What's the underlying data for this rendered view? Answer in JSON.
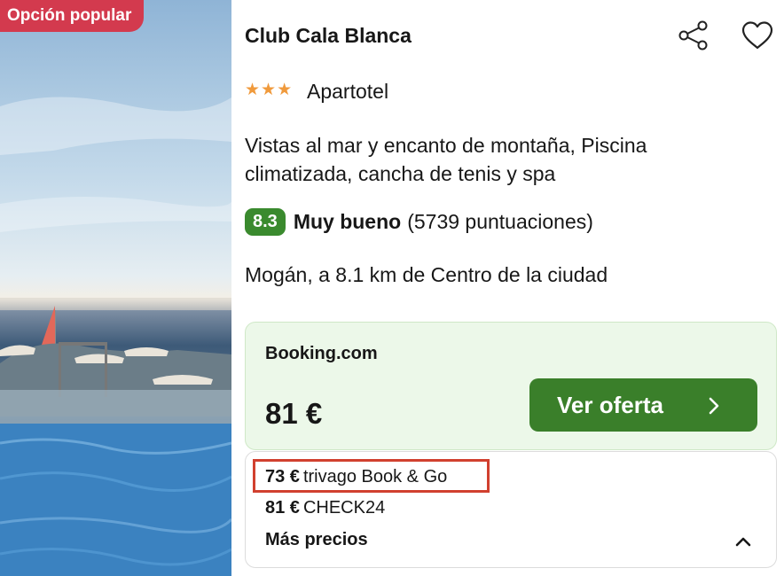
{
  "hero": {
    "badge": "Opción popular"
  },
  "hotel": {
    "name": "Club Cala Blanca",
    "stars": 3,
    "property_type": "Apartotel",
    "description": "Vistas al mar y encanto de montaña, Piscina climatizada, cancha de tenis y spa",
    "rating": {
      "score": "8.3",
      "label": "Muy bueno",
      "count": "(5739 puntuaciones)"
    },
    "location": "Mogán, a 8.1 km de Centro de la ciudad"
  },
  "actions": {
    "share_icon": "share-icon",
    "favorite_icon": "heart-icon"
  },
  "deal": {
    "provider": "Booking.com",
    "price": "81 €",
    "cta_label": "Ver oferta"
  },
  "other_offers": [
    {
      "price": "73 €",
      "provider": "trivago Book & Go"
    },
    {
      "price": "81 €",
      "provider": "CHECK24"
    }
  ],
  "more_prices": {
    "label": "Más precios"
  },
  "colors": {
    "badge": "#d33a4e",
    "score": "#3a8a2e",
    "cta": "#3a7f2a",
    "deal_bg": "#ecf8e9",
    "star": "#f09a3c",
    "highlight": "#d1402f"
  }
}
